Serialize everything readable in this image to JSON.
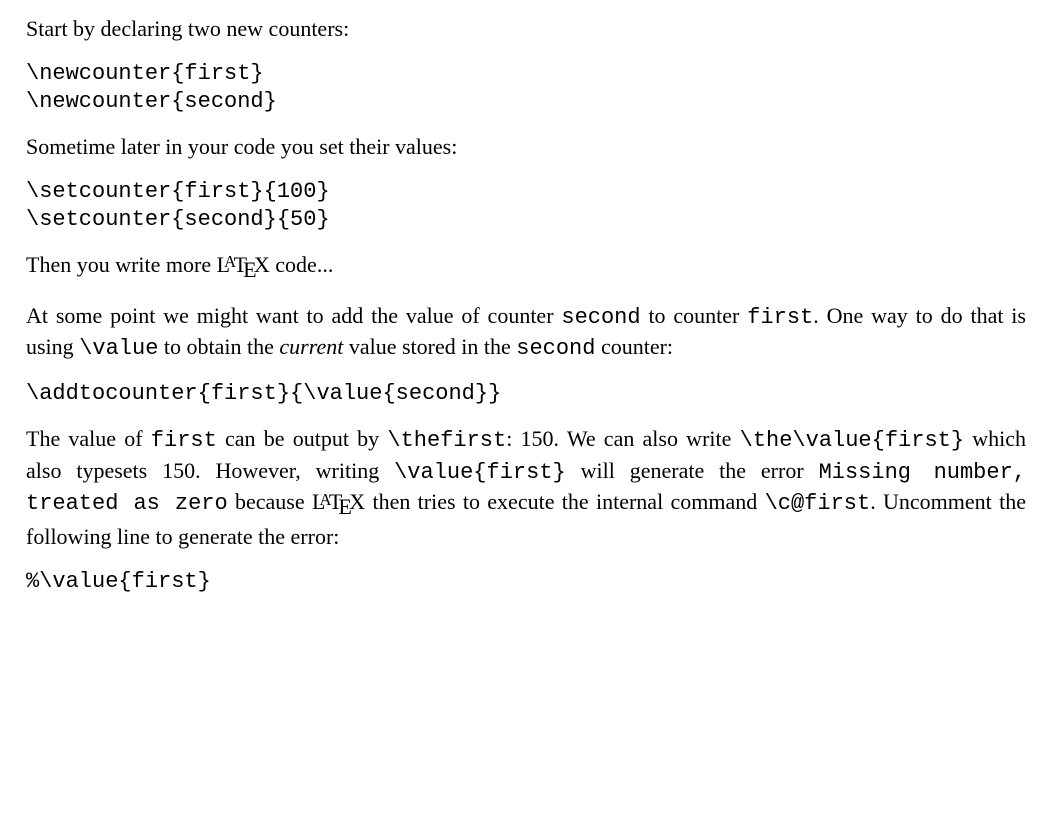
{
  "p1": "Start by declaring two new counters:",
  "code1_l1": "\\newcounter{first}",
  "code1_l2": "\\newcounter{second}",
  "p2": "Sometime later in your code you set their values:",
  "code2_l1": "\\setcounter{first}{100}",
  "code2_l2": "\\setcounter{second}{50}",
  "p3_a": "Then you write more ",
  "p3_b": " code...",
  "p4_a": "At some point we might want to add the value of counter ",
  "p4_b": "second",
  "p4_c": " to counter ",
  "p4_d": "first",
  "p4_e": ". One way to do that is using ",
  "p4_f": "\\value",
  "p4_g": " to obtain the ",
  "p4_h": "current",
  "p4_i": " value stored in the ",
  "p4_j": "second",
  "p4_k": " counter:",
  "code3": "\\addtocounter{first}{\\value{second}}",
  "p5_a": "The value of ",
  "p5_b": "first",
  "p5_c": " can be output by ",
  "p5_d": "\\thefirst",
  "p5_e": ": 150.  We can also write ",
  "p5_f": "\\the\\value{first}",
  "p5_g": " which also typesets 150. However, writing ",
  "p5_h": "\\value{first}",
  "p5_i": " will generate the error ",
  "p5_j": "Missing number, treated as zero",
  "p5_k": " because ",
  "p5_l": " then tries to execute the internal command ",
  "p5_m": "\\c@first",
  "p5_n": ". Uncomment the following line to generate the error:",
  "code4": "%\\value{first}"
}
